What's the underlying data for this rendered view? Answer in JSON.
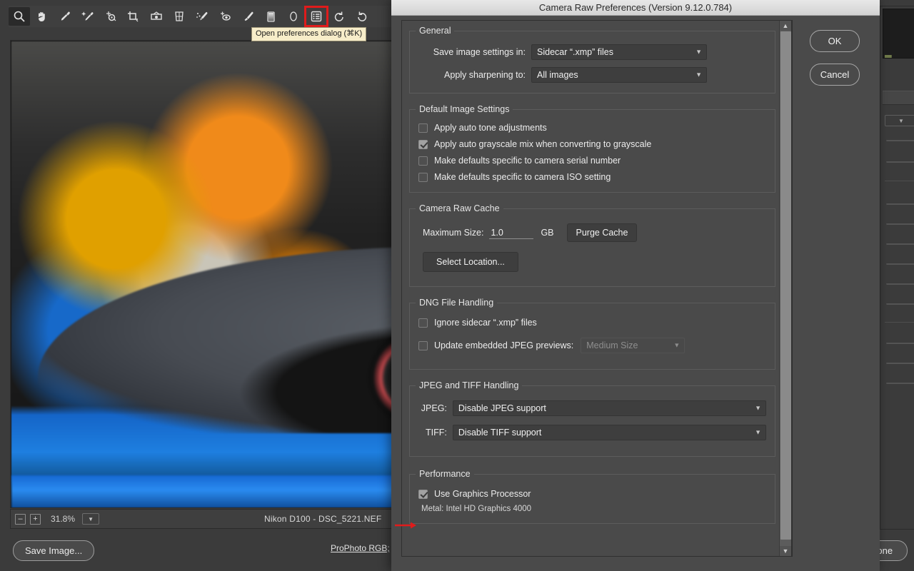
{
  "app": {
    "toolbar_tools": [
      {
        "name": "zoom-tool",
        "active": true
      },
      {
        "name": "hand-tool",
        "active": false
      },
      {
        "name": "white-balance-tool",
        "active": false
      },
      {
        "name": "color-sampler-tool",
        "active": false
      },
      {
        "name": "targeted-adjustment-tool",
        "active": false
      },
      {
        "name": "crop-tool",
        "active": false
      },
      {
        "name": "straighten-tool",
        "active": false
      },
      {
        "name": "transform-tool",
        "active": false
      },
      {
        "name": "spot-removal-tool",
        "active": false
      },
      {
        "name": "red-eye-removal-tool",
        "active": false
      },
      {
        "name": "adjustment-brush-tool",
        "active": false
      },
      {
        "name": "graduated-filter-tool",
        "active": false
      },
      {
        "name": "radial-filter-tool",
        "active": false
      },
      {
        "name": "preferences-tool",
        "active": false,
        "highlighted": true
      },
      {
        "name": "rotate-counterclockwise-tool",
        "active": false
      },
      {
        "name": "rotate-clockwise-tool",
        "active": false
      }
    ],
    "tooltip": "Open preferences dialog (⌘K)",
    "statusbar": {
      "zoom_out": "–",
      "zoom_in": "+",
      "zoom_level": "31.8%",
      "file_info": "Nikon D100  -  DSC_5221.NEF"
    },
    "footer": {
      "save_image": "Save Image...",
      "workflow_link": "ProPhoto RGB;",
      "done": "Done"
    }
  },
  "dialog": {
    "title": "Camera Raw Preferences  (Version 9.12.0.784)",
    "buttons": {
      "ok": "OK",
      "cancel": "Cancel"
    },
    "groups": {
      "general": {
        "legend": "General",
        "save_settings_label": "Save image settings in:",
        "save_settings_value": "Sidecar “.xmp” files",
        "sharpening_label": "Apply sharpening to:",
        "sharpening_value": "All images"
      },
      "default_image_settings": {
        "legend": "Default Image Settings",
        "items": [
          {
            "label": "Apply auto tone adjustments",
            "checked": false
          },
          {
            "label": "Apply auto grayscale mix when converting to grayscale",
            "checked": true
          },
          {
            "label": "Make defaults specific to camera serial number",
            "checked": false
          },
          {
            "label": "Make defaults specific to camera ISO setting",
            "checked": false
          }
        ]
      },
      "camera_raw_cache": {
        "legend": "Camera Raw Cache",
        "max_size_label": "Maximum Size:",
        "max_size_value": "1.0",
        "unit": "GB",
        "purge_button": "Purge Cache",
        "select_location_button": "Select Location..."
      },
      "dng_file_handling": {
        "legend": "DNG File Handling",
        "ignore_sidecar": {
          "label": "Ignore sidecar “.xmp” files",
          "checked": false
        },
        "update_previews": {
          "label": "Update embedded JPEG previews:",
          "checked": false
        },
        "preview_size_value": "Medium Size"
      },
      "jpeg_tiff_handling": {
        "legend": "JPEG and TIFF Handling",
        "jpeg_label": "JPEG:",
        "jpeg_value": "Disable JPEG support",
        "tiff_label": "TIFF:",
        "tiff_value": "Disable TIFF support"
      },
      "performance": {
        "legend": "Performance",
        "use_gpu": {
          "label": "Use Graphics Processor",
          "checked": true
        },
        "gpu_info": "Metal: Intel HD Graphics 4000"
      }
    }
  },
  "colors": {
    "annotation_red": "#e01b1b",
    "dialog_bg": "#4a4a4a",
    "titlebar": "#dedede",
    "tooltip_bg": "#f7edc9"
  }
}
